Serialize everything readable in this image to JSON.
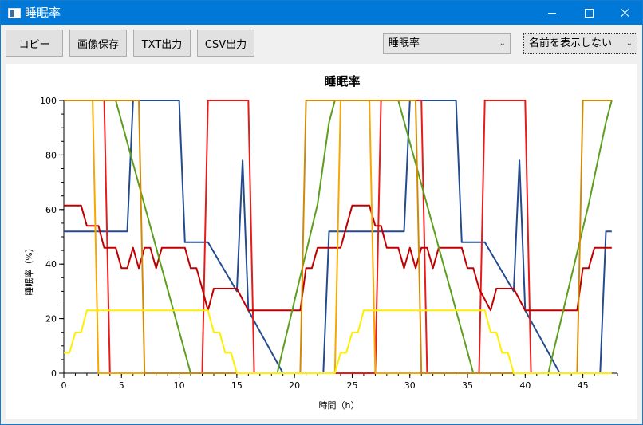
{
  "window": {
    "title": "睡眠率"
  },
  "toolbar": {
    "copy_label": "コピー",
    "save_image_label": "画像保存",
    "txt_label": "TXT出力",
    "csv_label": "CSV出力",
    "metric_select": "睡眠率",
    "name_select": "名前を表示しない"
  },
  "chart_data": {
    "type": "line",
    "title": "睡眠率",
    "xlabel": "時間（h）",
    "ylabel": "睡眠率（%）",
    "xlim": [
      0,
      48
    ],
    "ylim": [
      0,
      100
    ],
    "x_ticks": [
      0,
      5,
      10,
      15,
      20,
      25,
      30,
      35,
      40,
      45
    ],
    "y_ticks": [
      0,
      20,
      40,
      60,
      80,
      100
    ],
    "grid": false,
    "series": [
      {
        "color": "#244b8f",
        "points": [
          [
            0,
            52
          ],
          [
            5.5,
            52
          ],
          [
            6,
            100
          ],
          [
            10,
            100
          ],
          [
            10.5,
            48
          ],
          [
            12.5,
            48
          ],
          [
            15,
            30
          ],
          [
            15.5,
            78
          ],
          [
            16,
            23
          ],
          [
            19,
            0
          ],
          [
            22.5,
            0
          ],
          [
            23,
            52
          ],
          [
            29.5,
            52
          ],
          [
            30,
            100
          ],
          [
            34,
            100
          ],
          [
            34.5,
            48
          ],
          [
            36.5,
            48
          ],
          [
            39,
            30
          ],
          [
            39.5,
            78
          ],
          [
            40,
            23
          ],
          [
            43,
            0
          ],
          [
            46.5,
            0
          ],
          [
            47,
            52
          ],
          [
            47.5,
            52
          ]
        ]
      },
      {
        "color": "#e81b1b",
        "points": [
          [
            0,
            100
          ],
          [
            3.5,
            100
          ],
          [
            4,
            0
          ],
          [
            12,
            0
          ],
          [
            12.5,
            100
          ],
          [
            16,
            100
          ],
          [
            16.5,
            0
          ],
          [
            27,
            0
          ],
          [
            27.5,
            100
          ],
          [
            31,
            100
          ],
          [
            31.5,
            0
          ],
          [
            36,
            0
          ],
          [
            36.5,
            100
          ],
          [
            40,
            100
          ],
          [
            40.5,
            0
          ],
          [
            47.5,
            0
          ]
        ]
      },
      {
        "color": "#c00000",
        "points": [
          [
            0,
            61.5
          ],
          [
            1.5,
            61.5
          ],
          [
            2,
            54
          ],
          [
            3,
            54
          ],
          [
            3.5,
            46
          ],
          [
            4.5,
            46
          ],
          [
            5,
            38.5
          ],
          [
            5.5,
            38.5
          ],
          [
            6,
            46
          ],
          [
            6.5,
            38.5
          ],
          [
            7,
            46
          ],
          [
            7.5,
            46
          ],
          [
            8,
            38.5
          ],
          [
            8.5,
            46
          ],
          [
            10.5,
            46
          ],
          [
            11,
            38.5
          ],
          [
            11.5,
            38.5
          ],
          [
            12,
            31
          ],
          [
            12.5,
            23
          ],
          [
            13,
            31
          ],
          [
            15,
            31
          ],
          [
            16,
            23
          ],
          [
            20.5,
            23
          ],
          [
            21,
            38.5
          ],
          [
            21.5,
            38.5
          ],
          [
            22,
            46
          ],
          [
            24,
            46
          ],
          [
            25,
            61.5
          ],
          [
            26.5,
            61.5
          ],
          [
            27,
            54
          ],
          [
            27.5,
            54
          ],
          [
            28,
            46
          ],
          [
            29,
            46
          ],
          [
            29.5,
            38.5
          ],
          [
            30,
            46
          ],
          [
            30.5,
            38.5
          ],
          [
            31,
            46
          ],
          [
            31.5,
            46
          ],
          [
            32,
            38.5
          ],
          [
            32.5,
            46
          ],
          [
            34.5,
            46
          ],
          [
            35,
            38.5
          ],
          [
            35.5,
            38.5
          ],
          [
            36,
            31
          ],
          [
            37,
            23
          ],
          [
            37.5,
            31
          ],
          [
            39,
            31
          ],
          [
            40,
            23
          ],
          [
            44.5,
            23
          ],
          [
            45,
            38.5
          ],
          [
            45.5,
            38.5
          ],
          [
            46,
            46
          ],
          [
            47.5,
            46
          ]
        ]
      },
      {
        "color": "#5b9f1c",
        "points": [
          [
            0,
            100
          ],
          [
            4.5,
            100
          ],
          [
            11,
            0
          ],
          [
            18.5,
            0
          ],
          [
            22,
            62
          ],
          [
            23,
            92
          ],
          [
            23.5,
            100
          ],
          [
            29,
            100
          ],
          [
            35.5,
            0
          ],
          [
            42,
            0
          ],
          [
            45.5,
            62
          ],
          [
            47,
            92
          ],
          [
            47.5,
            100
          ]
        ]
      },
      {
        "color": "#f7a800",
        "points": [
          [
            0,
            100
          ],
          [
            2.5,
            100
          ],
          [
            3,
            0
          ],
          [
            23.5,
            0
          ],
          [
            24,
            100
          ],
          [
            26.5,
            100
          ],
          [
            27,
            0
          ],
          [
            47.5,
            0
          ]
        ]
      },
      {
        "color": "#d18a08",
        "points": [
          [
            0,
            100
          ],
          [
            6.5,
            100
          ],
          [
            7,
            0
          ],
          [
            20.5,
            0
          ],
          [
            21,
            100
          ],
          [
            30.5,
            100
          ],
          [
            31,
            0
          ],
          [
            44.5,
            0
          ],
          [
            45,
            100
          ],
          [
            47.5,
            100
          ]
        ]
      },
      {
        "color": "#ffee00",
        "points": [
          [
            0,
            7.5
          ],
          [
            0.5,
            7.5
          ],
          [
            1,
            15
          ],
          [
            1.5,
            15
          ],
          [
            2,
            23
          ],
          [
            12,
            23
          ],
          [
            12.5,
            23
          ],
          [
            13,
            15
          ],
          [
            13.5,
            15
          ],
          [
            14,
            7.5
          ],
          [
            14.5,
            7.5
          ],
          [
            15,
            0
          ],
          [
            23.5,
            0
          ],
          [
            24,
            7.5
          ],
          [
            24.5,
            7.5
          ],
          [
            25,
            15
          ],
          [
            25.5,
            15
          ],
          [
            26,
            23
          ],
          [
            36.5,
            23
          ],
          [
            37,
            15
          ],
          [
            37.5,
            15
          ],
          [
            38,
            7.5
          ],
          [
            38.5,
            7.5
          ],
          [
            39,
            0
          ],
          [
            47.5,
            0
          ]
        ]
      }
    ]
  }
}
